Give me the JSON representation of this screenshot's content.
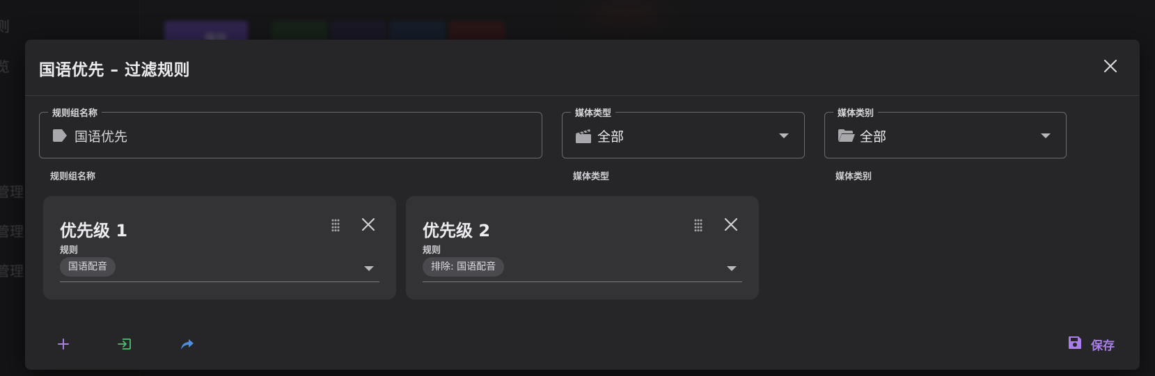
{
  "background": {
    "sidebar_items": [
      "则",
      "览",
      "管理",
      "管理",
      "管理"
    ],
    "toolbar_save_label": "保存"
  },
  "dialog": {
    "title": "国语优先 – 过滤规则",
    "fields": {
      "group_name": {
        "legend": "规则组名称",
        "value": "国语优先",
        "helper": "规则组名称",
        "icon": "tag-icon"
      },
      "media_type": {
        "legend": "媒体类型",
        "value": "全部",
        "helper": "媒体类型",
        "icon": "movie-clapper-icon"
      },
      "media_category": {
        "legend": "媒体类别",
        "value": "全部",
        "helper": "媒体类别",
        "icon": "folder-open-icon"
      }
    },
    "priorities": [
      {
        "title": "优先级 1",
        "rule_label": "规则",
        "chip": "国语配音"
      },
      {
        "title": "优先级 2",
        "rule_label": "规则",
        "chip": "排除: 国语配音"
      }
    ],
    "actions": {
      "add_icon": "plus-icon",
      "import_icon": "import-icon",
      "share_icon": "share-icon",
      "save_label": "保存"
    }
  },
  "colors": {
    "accent_purple": "#a97ee8",
    "import_green": "#4fbf6f",
    "share_blue": "#4a90e2"
  }
}
